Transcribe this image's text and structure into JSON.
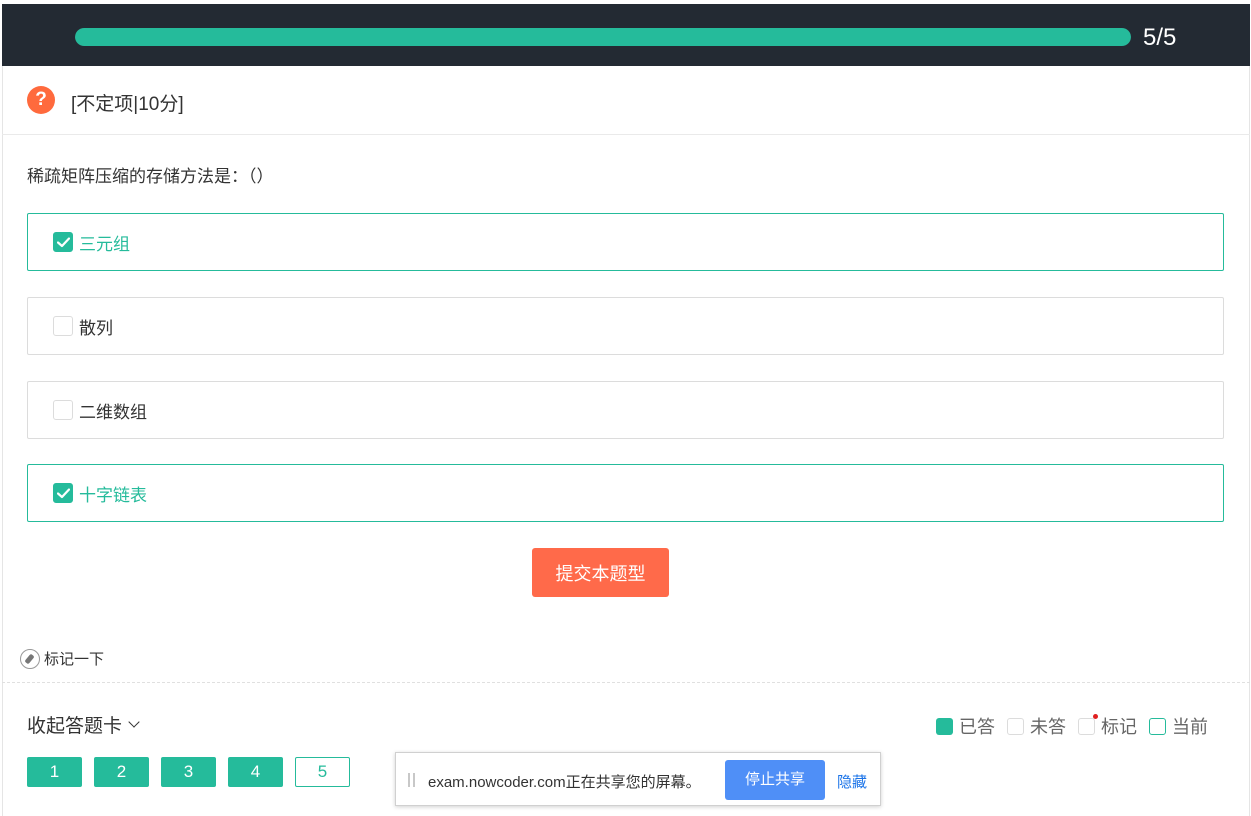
{
  "progress": {
    "text": "5/5",
    "fraction": 1.0
  },
  "question": {
    "type_label": "[不定项|10分]",
    "stem": "稀疏矩阵压缩的存储方法是：（）",
    "options": [
      {
        "label": "三元组",
        "checked": true
      },
      {
        "label": "散列",
        "checked": false
      },
      {
        "label": "二维数组",
        "checked": false
      },
      {
        "label": "十字链表",
        "checked": true
      }
    ],
    "submit_label": "提交本题型",
    "mark_label": "标记一下"
  },
  "answer_card": {
    "toggle_label": "收起答题卡",
    "legend": {
      "answered": "已答",
      "unanswered": "未答",
      "marked": "标记",
      "current": "当前"
    },
    "numbers": [
      "1",
      "2",
      "3",
      "4",
      "5"
    ],
    "current_index": 4
  },
  "share_bar": {
    "message": "exam.nowcoder.com正在共享您的屏幕。",
    "stop_label": "停止共享",
    "hide_label": "隐藏"
  },
  "colors": {
    "accent": "#25bb9b",
    "submit": "#ff6a4a",
    "header_bg": "#232a33",
    "share_button": "#4f8ff7"
  }
}
